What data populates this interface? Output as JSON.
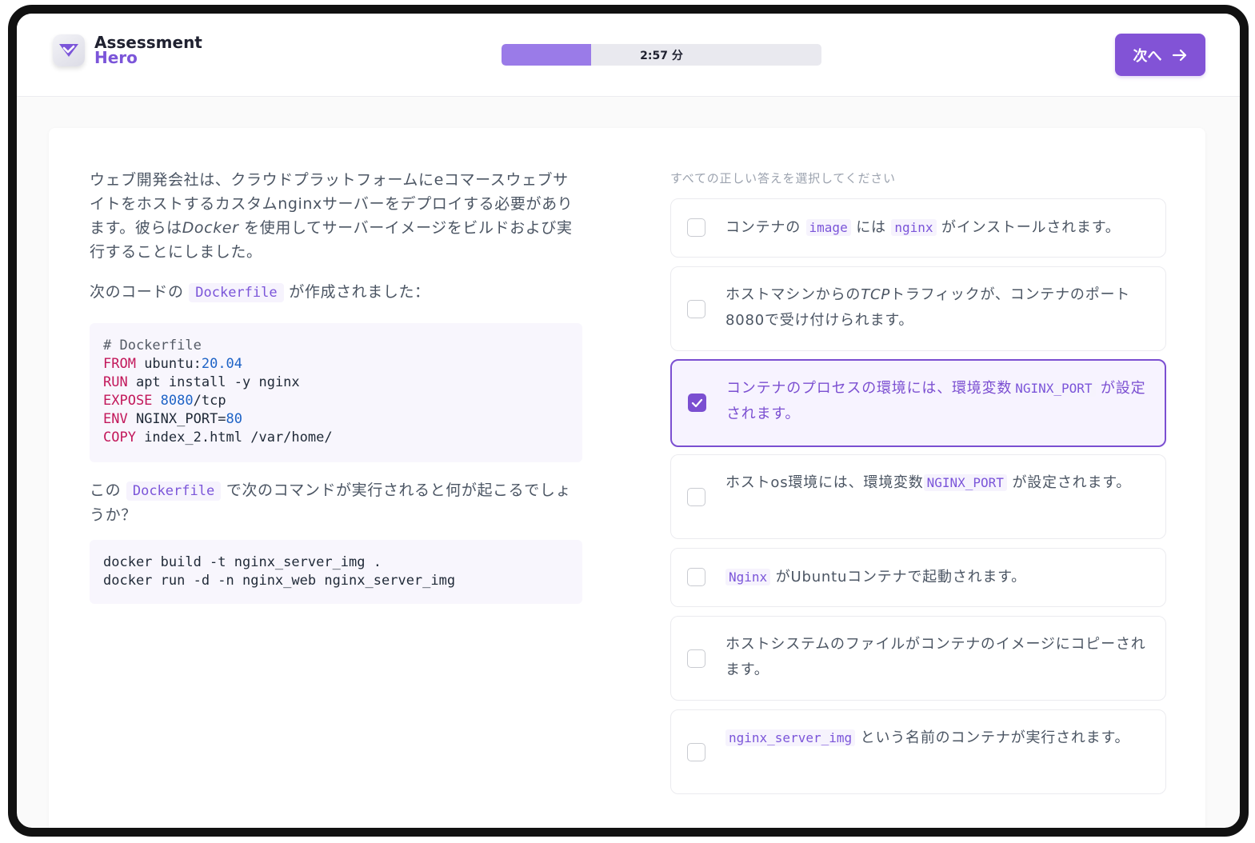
{
  "header": {
    "logo_line1": "Assessment",
    "logo_line2": "Hero",
    "timer_text": "2:57 分",
    "timer_progress": 0.28,
    "next_label": "次へ"
  },
  "question": {
    "intro": "ウェブ開発会社は、クラウドプラットフォームにeコマースウェブサイトをホストするカスタムnginxサーバーをデプロイする必要があります。彼らは",
    "intro_em": "Docker",
    "intro_end": " を使用してサーバーイメージをビルドおよび実行することにしました。",
    "code_lead_pre": "次のコードの ",
    "code_lead_code": "Dockerfile",
    "code_lead_post": " が作成されました：",
    "dockerfile": {
      "comment": "# Dockerfile",
      "from_kw": "FROM",
      "from_val": " ubuntu:",
      "from_num": "20.04",
      "run_kw": "RUN",
      "run_val": " apt install -y nginx",
      "expose_kw": "EXPOSE",
      "expose_num": "8080",
      "expose_val": "/tcp",
      "env_kw": "ENV",
      "env_val": " NGINX_PORT=",
      "env_num": "80",
      "copy_kw": "COPY",
      "copy_val": " index_2.html /var/home/"
    },
    "ask_pre": "この ",
    "ask_code": "Dockerfile",
    "ask_post": " で次のコマンドが実行されると何が起こるでしょうか？",
    "commands": [
      "docker build -t nginx_server_img .",
      "docker run -d -n nginx_web nginx_server_img"
    ]
  },
  "answers": {
    "prompt": "すべての正しい答えを選択してください",
    "options": [
      {
        "pre": "コンテナの ",
        "code": "image",
        "mid": " には ",
        "code2": "nginx",
        "post": " がインストールされます。",
        "checked": false
      },
      {
        "text": "ホストマシンからの",
        "em": "TCP",
        "post": "トラフィックが、コンテナのポート8080で受け付けられます。",
        "checked": false
      },
      {
        "text": "コンテナのプロセスの環境には、環境変数",
        "code": "NGINX_PORT",
        "post": " が設定されます。",
        "checked": true
      },
      {
        "text": "ホストos環境には、環境変数",
        "code": "NGINX_PORT",
        "post": " が設定されます。",
        "checked": false
      },
      {
        "code": "Nginx",
        "post": " がUbuntuコンテナで起動されます。",
        "checked": false
      },
      {
        "text": "ホストシステムのファイルがコンテナのイメージにコピーされます。",
        "checked": false
      },
      {
        "code": "nginx_server_img",
        "post": " という名前のコンテナが実行されます。",
        "checked": false
      }
    ]
  }
}
